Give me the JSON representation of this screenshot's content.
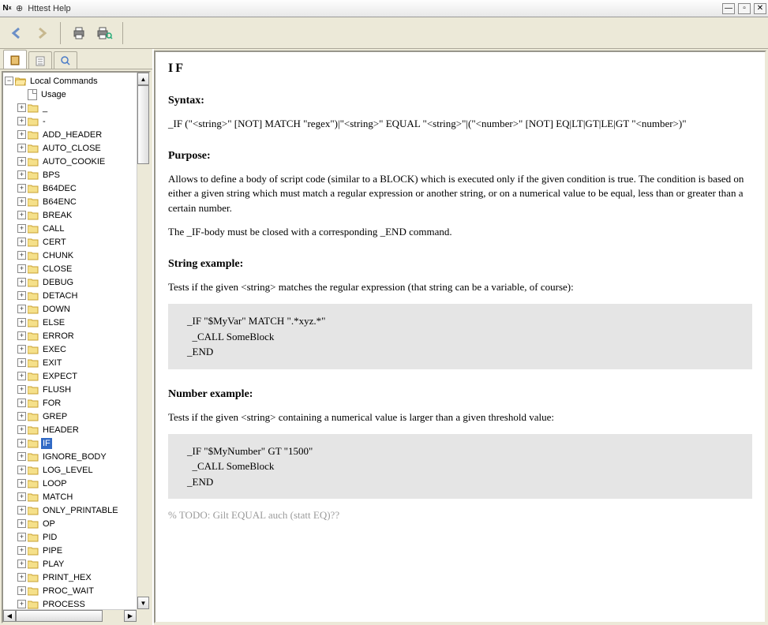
{
  "window": {
    "title": "Httest Help"
  },
  "tree": {
    "root": "Local Commands",
    "usage": "Usage",
    "items": [
      "_",
      "-",
      "ADD_HEADER",
      "AUTO_CLOSE",
      "AUTO_COOKIE",
      "BPS",
      "B64DEC",
      "B64ENC",
      "BREAK",
      "CALL",
      "CERT",
      "CHUNK",
      "CLOSE",
      "DEBUG",
      "DETACH",
      "DOWN",
      "ELSE",
      "ERROR",
      "EXEC",
      "EXIT",
      "EXPECT",
      "FLUSH",
      "FOR",
      "GREP",
      "HEADER",
      "IF",
      "IGNORE_BODY",
      "LOG_LEVEL",
      "LOOP",
      "MATCH",
      "ONLY_PRINTABLE",
      "OP",
      "PID",
      "PIPE",
      "PLAY",
      "PRINT_HEX",
      "PROC_WAIT",
      "PROCESS"
    ],
    "selected": "IF"
  },
  "doc": {
    "title": "IF",
    "syntax_label": "Syntax:",
    "syntax_text": "_IF (\"<string>\" [NOT] MATCH \"regex\")|\"<string>\" EQUAL \"<string>\"|(\"<number>\" [NOT] EQ|LT|GT|LE|GT \"<number>)\"",
    "purpose_label": "Purpose:",
    "purpose_text1": "Allows to define a body of script code (similar to a BLOCK) which is executed only if the given condition is true. The condition is based on either a given string which must match a regular expression or another string, or on a numerical value to be equal, less than or greater than a certain number.",
    "purpose_text2": "The _IF-body must be closed with a corresponding _END command.",
    "string_label": "String example:",
    "string_text": "Tests if the given <string> matches the regular expression (that string can be a variable, of course):",
    "string_code": "_IF \"$MyVar\" MATCH \".*xyz.*\"\n  _CALL SomeBlock\n_END",
    "number_label": "Number example:",
    "number_text": "Tests if the given <string> containing a numerical value is larger than a given threshold value:",
    "number_code": "_IF \"$MyNumber\" GT \"1500\"\n  _CALL SomeBlock\n_END",
    "todo": "% TODO: Gilt EQUAL auch (statt EQ)??"
  }
}
